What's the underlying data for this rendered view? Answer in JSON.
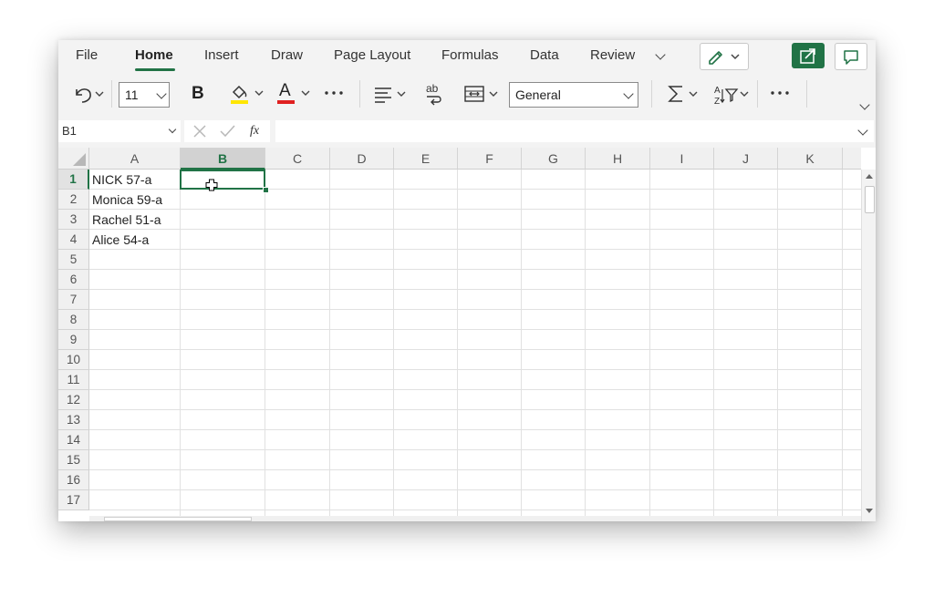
{
  "ribbon": {
    "tabs": [
      {
        "label": "File"
      },
      {
        "label": "Home",
        "active": true
      },
      {
        "label": "Insert"
      },
      {
        "label": "Draw"
      },
      {
        "label": "Page Layout"
      },
      {
        "label": "Formulas"
      },
      {
        "label": "Data"
      },
      {
        "label": "Review"
      }
    ]
  },
  "toolbar": {
    "font_size": "11",
    "bold_label": "B",
    "font_color_label": "A",
    "number_format": "General",
    "fill_color": "#ffe600",
    "font_color": "#e02020",
    "icons": [
      "undo-icon",
      "bold-icon",
      "fill-color-icon",
      "font-color-icon",
      "more-icon",
      "align-icon",
      "wrap-text-icon",
      "merge-icon",
      "sum-icon",
      "sort-filter-icon",
      "more-icon",
      "collapse-icon"
    ]
  },
  "formula_bar": {
    "name_box": "B1",
    "fx_label": "fx",
    "formula": ""
  },
  "sheet": {
    "columns": [
      "A",
      "B",
      "C",
      "D",
      "E",
      "F",
      "G",
      "H",
      "I",
      "J",
      "K"
    ],
    "selected_column": "B",
    "rows": [
      "1",
      "2",
      "3",
      "4",
      "5",
      "6",
      "7",
      "8",
      "9",
      "10",
      "11",
      "12",
      "13",
      "14",
      "15",
      "16",
      "17"
    ],
    "selected_row": "1",
    "cells_A": [
      "NICK 57-a",
      "Monica 59-a",
      "Rachel 51-a",
      "Alice 54-a"
    ],
    "accent_color": "#217346"
  }
}
